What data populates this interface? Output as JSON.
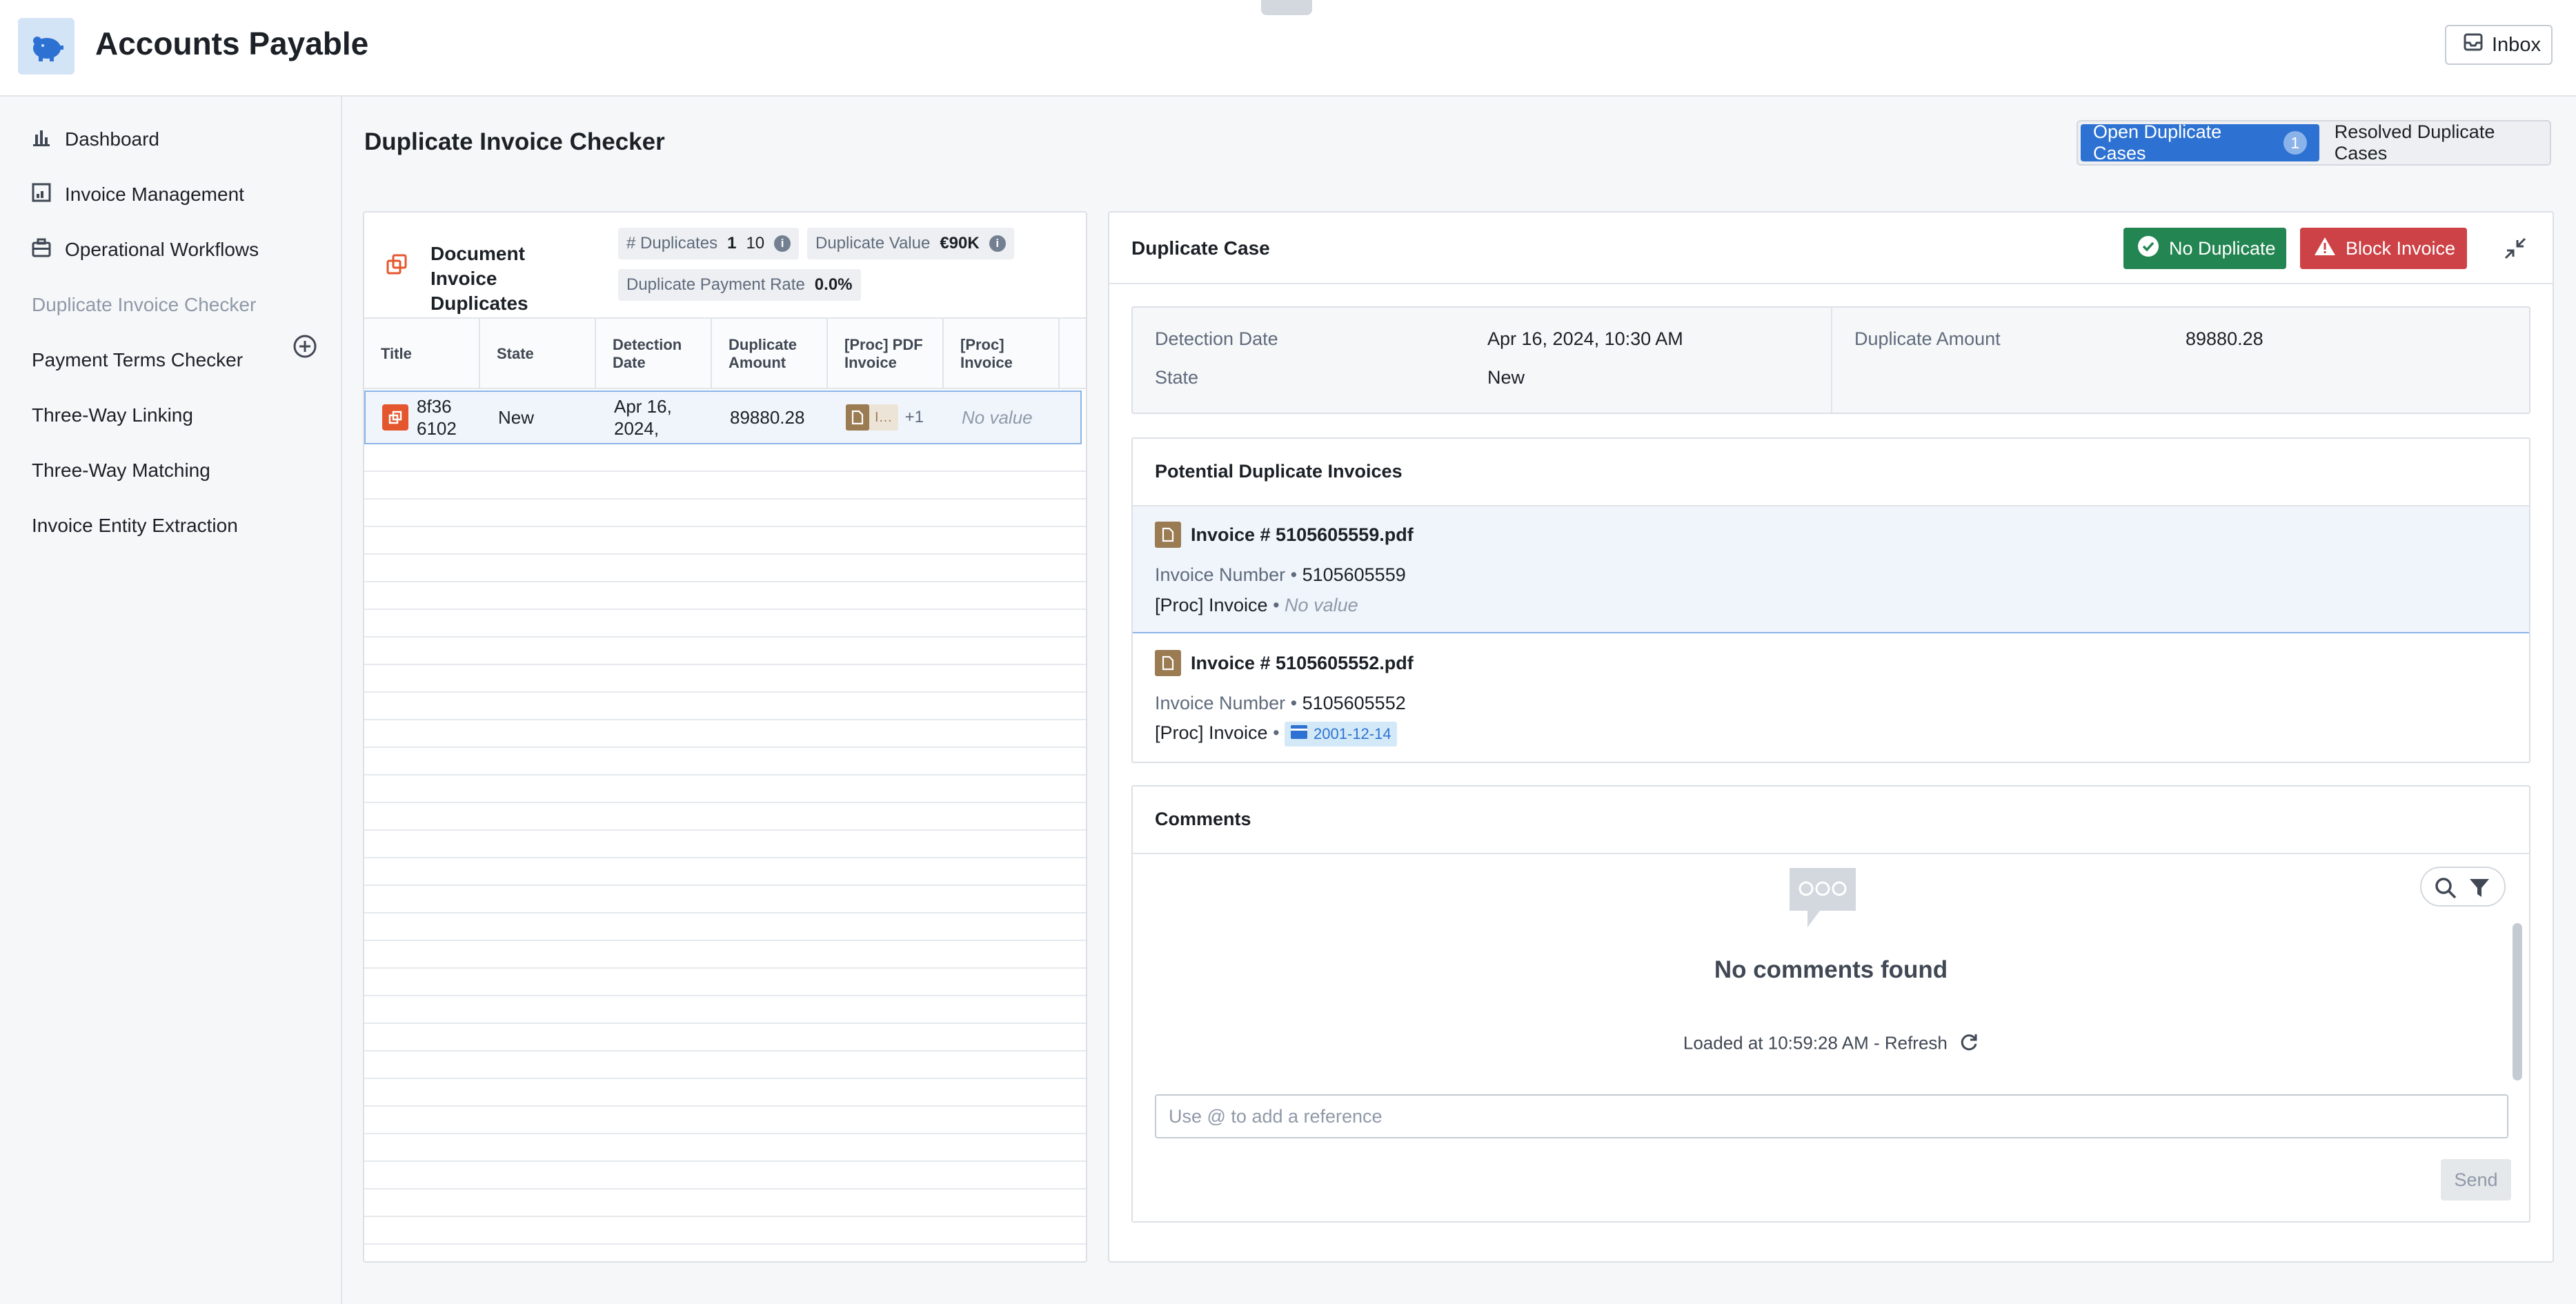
{
  "app": {
    "title": "Accounts Payable",
    "inbox_label": "Inbox"
  },
  "sidebar": {
    "items": [
      {
        "label": "Dashboard",
        "icon": "bar-chart-icon"
      },
      {
        "label": "Invoice Management",
        "icon": "table-icon"
      },
      {
        "label": "Operational Workflows",
        "icon": "briefcase-icon"
      },
      {
        "label": "Duplicate Invoice Checker",
        "active": true
      },
      {
        "label": "Payment Terms Checker"
      },
      {
        "label": "Three-Way Linking"
      },
      {
        "label": "Three-Way Matching"
      },
      {
        "label": "Invoice Entity Extraction"
      }
    ]
  },
  "page": {
    "title": "Duplicate Invoice Checker",
    "tabs": {
      "open_label": "Open Duplicate Cases",
      "open_count": "1",
      "resolved_label": "Resolved Duplicate Cases"
    }
  },
  "left_panel": {
    "title": "Document Invoice Duplicates",
    "stats": {
      "duplicates_label": "# Duplicates",
      "duplicates_value_1": "1",
      "duplicates_value_2": "10",
      "value_label": "Duplicate Value",
      "value_value": "€90K",
      "rate_label": "Duplicate Payment Rate",
      "rate_value": "0.0%"
    },
    "columns": [
      "Title",
      "State",
      "Detection Date",
      "Duplicate Amount",
      "[Proc] PDF Invoice",
      "[Proc] Invoice"
    ],
    "rows": [
      {
        "title": "8f36 6102",
        "state": "New",
        "detection_date": "Apr 16, 2024,",
        "amount": "89880.28",
        "pdf_chip": "I…",
        "pdf_more": "+1",
        "proc_invoice": "No value"
      }
    ]
  },
  "case": {
    "title": "Duplicate Case",
    "no_duplicate_label": "No Duplicate",
    "block_label": "Block Invoice",
    "details": {
      "detection_date_label": "Detection Date",
      "detection_date_value": "Apr 16, 2024, 10:30 AM",
      "state_label": "State",
      "state_value": "New",
      "amount_label": "Duplicate Amount",
      "amount_value": "89880.28"
    },
    "potential": {
      "title": "Potential Duplicate Invoices",
      "items": [
        {
          "name": "Invoice # 5105605559.pdf",
          "number_label": "Invoice Number",
          "number_value": "5105605559",
          "proc_label": "[Proc] Invoice",
          "proc_value": "No value"
        },
        {
          "name": "Invoice # 5105605552.pdf",
          "number_label": "Invoice Number",
          "number_value": "5105605552",
          "proc_label": "[Proc] Invoice",
          "proc_value": "2001-12-14"
        }
      ]
    },
    "comments": {
      "title": "Comments",
      "empty": "No comments found",
      "loaded": "Loaded at 10:59:28 AM - Refresh",
      "placeholder": "Use @ to add a reference",
      "send_label": "Send"
    }
  },
  "colors": {
    "primary": "#2d72d2",
    "success": "#238551",
    "danger": "#cd4246",
    "doc_icon": "#9a7b52",
    "duplicate_icon": "#e4572e"
  }
}
